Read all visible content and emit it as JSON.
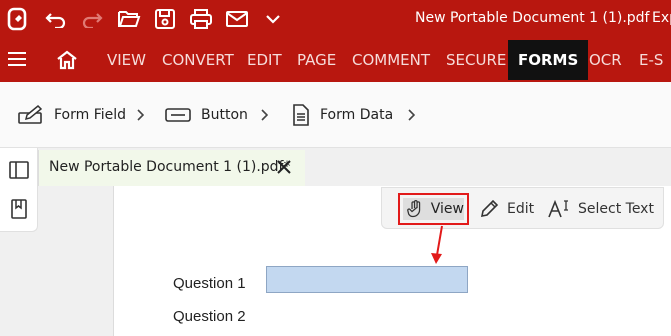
{
  "titlebar": {
    "title": "New Portable Document 1 (1).pdf",
    "title_overflow": "Exp",
    "icons": [
      "app-logo-icon",
      "undo-icon",
      "redo-icon",
      "open-folder-icon",
      "save-icon",
      "print-icon",
      "email-icon",
      "chevron-down-icon"
    ]
  },
  "menu": {
    "items": [
      "VIEW",
      "CONVERT",
      "EDIT",
      "PAGE",
      "COMMENT",
      "SECURE",
      "FORMS",
      "OCR",
      "E-S"
    ],
    "active": "FORMS"
  },
  "ribbon": {
    "form_field": "Form Field",
    "button": "Button",
    "form_data": "Form Data"
  },
  "document_tab": {
    "label": "New Portable Document 1 (1).pdf*"
  },
  "modes": {
    "view": "View",
    "edit": "Edit",
    "select_text": "Select Text"
  },
  "page": {
    "question1": "Question 1",
    "question2": "Question 2"
  },
  "colors": {
    "brand": "#b8170f",
    "highlight": "#e21a1a",
    "field_fill": "#c3d8f0"
  }
}
